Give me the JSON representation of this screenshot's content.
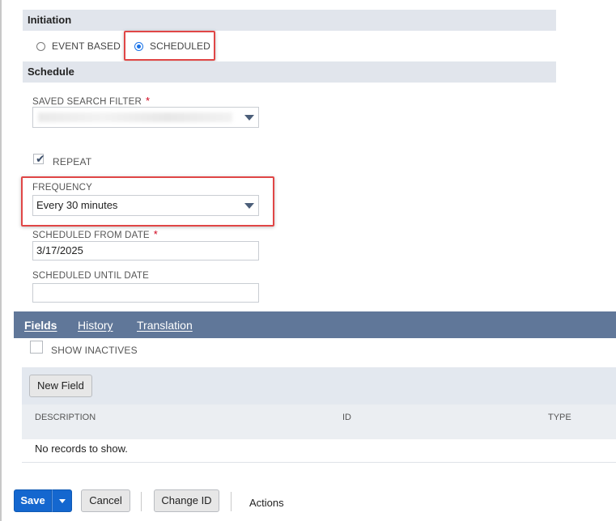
{
  "initiation": {
    "header": "Initiation",
    "options": [
      {
        "label": "EVENT BASED",
        "selected": false
      },
      {
        "label": "SCHEDULED",
        "selected": true
      }
    ]
  },
  "schedule": {
    "header": "Schedule",
    "saved_search_filter": {
      "label": "SAVED SEARCH FILTER",
      "required_mark": "*",
      "value": ""
    },
    "repeat": {
      "label": "REPEAT",
      "checked": true
    },
    "frequency": {
      "label": "FREQUENCY",
      "value": "Every 30 minutes"
    },
    "scheduled_from_date": {
      "label": "SCHEDULED FROM DATE",
      "required_mark": "*",
      "value": "3/17/2025"
    },
    "scheduled_until_date": {
      "label": "SCHEDULED UNTIL DATE",
      "value": ""
    }
  },
  "tabs": [
    {
      "label": "Fields",
      "active": true
    },
    {
      "label": "History",
      "active": false
    },
    {
      "label": "Translation",
      "active": false
    }
  ],
  "fields_tab": {
    "show_inactives": {
      "label": "SHOW INACTIVES",
      "checked": false
    },
    "new_field_button": "New Field",
    "columns": [
      "DESCRIPTION",
      "ID",
      "TYPE"
    ],
    "empty_message": "No records to show."
  },
  "footer": {
    "save": "Save",
    "cancel": "Cancel",
    "change_id": "Change ID",
    "actions": "Actions"
  },
  "colors": {
    "accent_blue": "#1467cf",
    "tab_bar": "#607799",
    "highlight_red": "#e04646",
    "section_header_bg": "#e1e5ec"
  },
  "icons": [
    "radio-icon",
    "checkbox-icon",
    "dropdown-arrow-icon",
    "checkmark-icon"
  ]
}
